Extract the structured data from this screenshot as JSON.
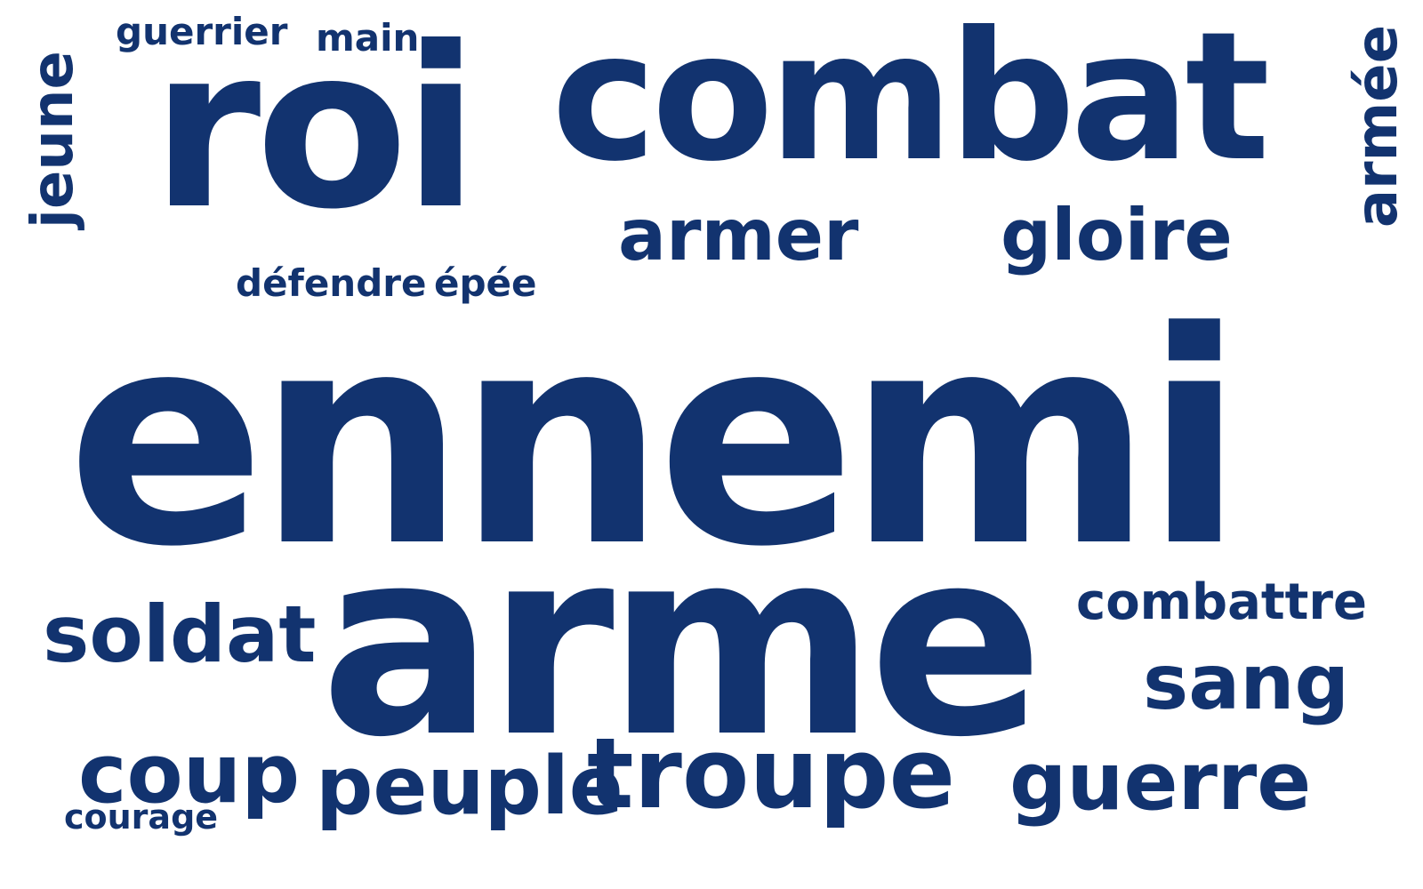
{
  "word_color": "#12336f",
  "background_color": "#ffffff",
  "words": {
    "ennemi": "ennemi",
    "arme": "arme",
    "roi": "roi",
    "combat": "combat",
    "armer": "armer",
    "gloire": "gloire",
    "guerrier": "guerrier",
    "main": "main",
    "defendre": "défendre",
    "epee": "épée",
    "soldat": "soldat",
    "combattre": "combattre",
    "sang": "sang",
    "coup": "coup",
    "courage": "courage",
    "peuple": "peuple",
    "troupe": "troupe",
    "guerre": "guerre",
    "jeune": "jeune",
    "armee": "armée"
  }
}
